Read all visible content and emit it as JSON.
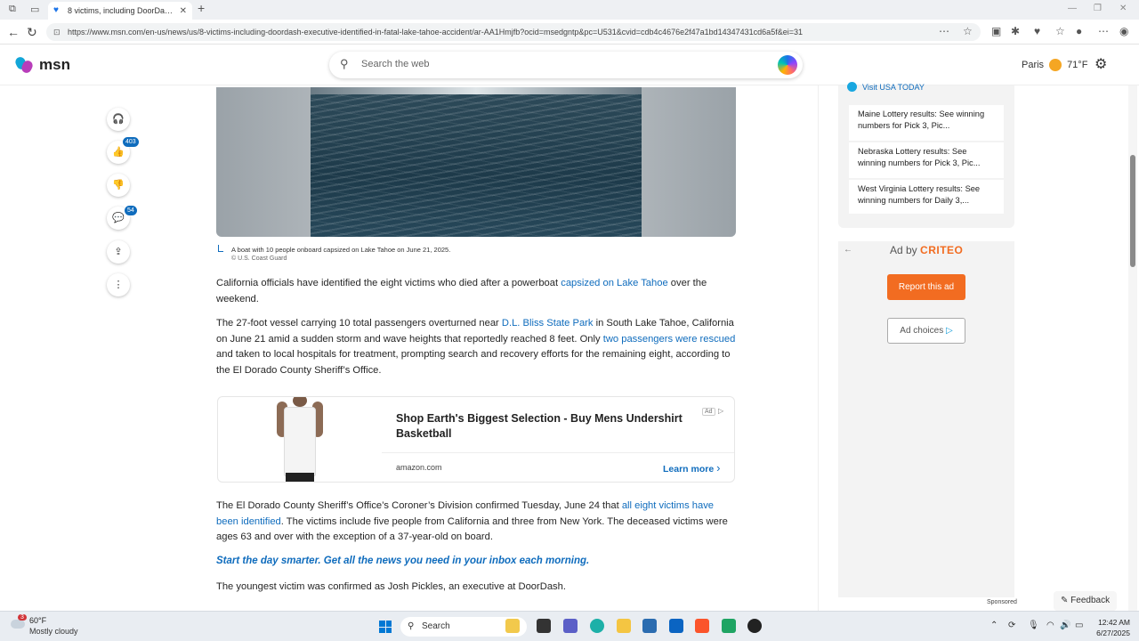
{
  "browser": {
    "tab_title": "8 victims, including DoorDash ex",
    "url": "https://www.msn.com/en-us/news/us/8-victims-including-doordash-executive-identified-in-fatal-lake-tahoe-accident/ar-AA1Hmjfb?ocid=msedgntp&pc=U531&cvid=cdb4c4676e2f47a1bd14347431cd6a5f&ei=31"
  },
  "header": {
    "logo_text": "msn",
    "search_placeholder": "Search the web",
    "weather_city": "Paris",
    "weather_temp": "71°F"
  },
  "rail": {
    "like_count": "403",
    "comment_count": "54"
  },
  "article": {
    "caption": "A boat with 10 people onboard capsized on Lake Tahoe on June 21, 2025.",
    "credit": "© U.S. Coast Guard",
    "p1_before": "California officials have identified the eight victims who died after a powerboat ",
    "p1_link": "capsized on Lake Tahoe",
    "p1_after": " over the weekend.",
    "p2_before": "The 27-foot vessel carrying 10 total passengers overturned near ",
    "p2_link1": "D.L. Bliss State Park",
    "p2_mid": " in South Lake Tahoe, California on June 21 amid a sudden storm and wave heights that reportedly reached 8 feet. Only ",
    "p2_link2": "two passengers were rescued",
    "p2_after": " and taken to local hospitals for treatment, prompting search and recovery efforts for the remaining eight, according to the El Dorado County Sheriff’s Office.",
    "p3_before": "The El Dorado County Sheriff’s Office’s Coroner’s Division confirmed Tuesday, June 24 that ",
    "p3_link": "all eight victims have been identified",
    "p3_after": ". The victims include five people from California and three from New York. The deceased victims were ages 63 and over with the exception of a 37-year-old on board.",
    "cta": "Start the day smarter. Get all the news you need in your inbox each morning.",
    "p4": "The youngest victim was confirmed as Josh Pickles, an executive at DoorDash."
  },
  "inline_ad": {
    "title": "Shop Earth's Biggest Selection - Buy Mens Undershirt Basketball",
    "tag": "Ad",
    "domain": "amazon.com",
    "cta": "Learn more"
  },
  "right_rail": {
    "visit": "Visit USA TODAY",
    "items": [
      "Maine Lottery results: See winning numbers for Pick 3, Pic...",
      "Nebraska Lottery results: See winning numbers for Pick 3, Pic...",
      "West Virginia Lottery results: See winning numbers for Daily 3,..."
    ],
    "ad_by": "Ad by",
    "ad_brand": "CRITEO",
    "report": "Report this ad",
    "choices": "Ad choices",
    "sponsored": "Sponsored",
    "feedback": "Feedback"
  },
  "taskbar": {
    "temp": "60°F",
    "condition": "Mostly cloudy",
    "notif": "3",
    "search": "Search",
    "time": "12:42 AM",
    "date": "6/27/2025"
  }
}
